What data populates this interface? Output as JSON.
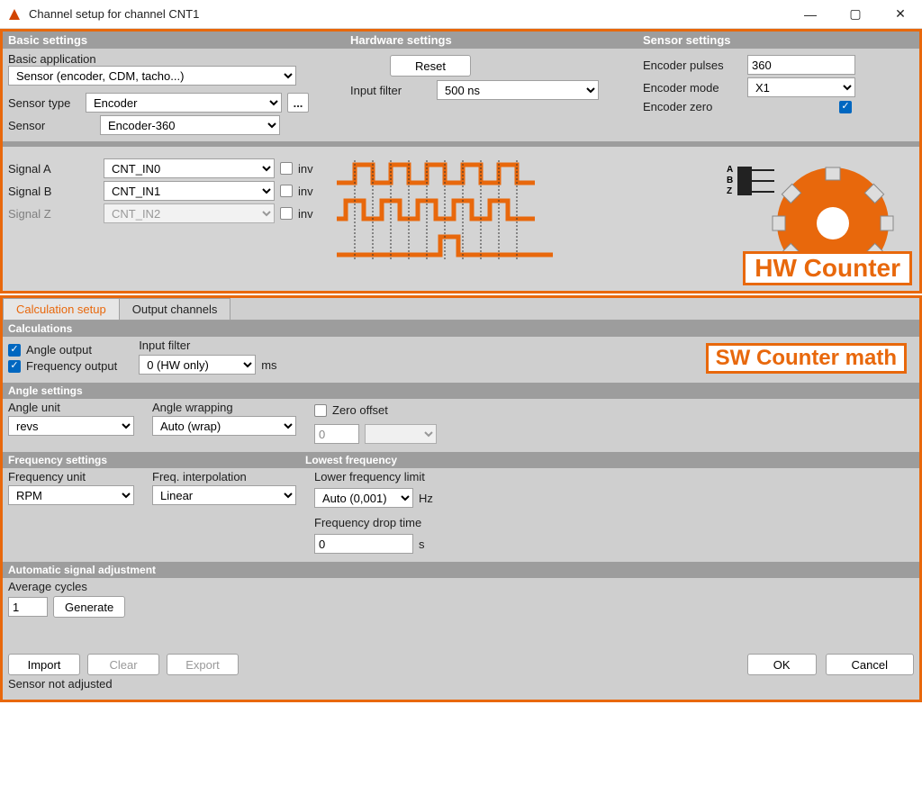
{
  "window": {
    "title": "Channel setup for channel CNT1"
  },
  "headers": {
    "basic": "Basic settings",
    "hardware": "Hardware settings",
    "sensor": "Sensor settings",
    "calc": "Calculations",
    "angle": "Angle settings",
    "freq": "Frequency settings",
    "lowestfreq": "Lowest frequency",
    "auto": "Automatic signal adjustment"
  },
  "basic": {
    "app_label": "Basic application",
    "app_value": "Sensor (encoder, CDM, tacho...)",
    "type_label": "Sensor type",
    "type_value": "Encoder",
    "sensor_label": "Sensor",
    "sensor_value": "Encoder-360",
    "dots": "..."
  },
  "hardware": {
    "reset": "Reset",
    "filter_label": "Input filter",
    "filter_value": "500 ns"
  },
  "sensor": {
    "pulses_label": "Encoder pulses",
    "pulses_value": "360",
    "mode_label": "Encoder mode",
    "mode_value": "X1",
    "zero_label": "Encoder zero"
  },
  "signals": {
    "a_label": "Signal A",
    "a_value": "CNT_IN0",
    "b_label": "Signal B",
    "b_value": "CNT_IN1",
    "z_label": "Signal Z",
    "z_value": "CNT_IN2",
    "inv": "inv",
    "abz_labels": "A\nB\nZ"
  },
  "badges": {
    "hw": "HW Counter",
    "sw": "SW Counter math"
  },
  "tabs": {
    "calc": "Calculation setup",
    "out": "Output channels"
  },
  "calc": {
    "angle_out": "Angle output",
    "freq_out": "Frequency output",
    "input_filter": "Input filter",
    "input_filter_value": "0 (HW only)",
    "ms": "ms"
  },
  "angle": {
    "unit_label": "Angle unit",
    "unit_value": "revs",
    "wrap_label": "Angle wrapping",
    "wrap_value": "Auto (wrap)",
    "zero_offset": "Zero offset",
    "zero_value": "0"
  },
  "freq": {
    "unit_label": "Frequency unit",
    "unit_value": "RPM",
    "interp_label": "Freq. interpolation",
    "interp_value": "Linear",
    "lower_label": "Lower frequency limit",
    "lower_value": "Auto (0,001)",
    "hz": "Hz",
    "drop_label": "Frequency drop time",
    "drop_value": "0",
    "s": "s"
  },
  "auto": {
    "avg_label": "Average cycles",
    "avg_value": "1",
    "generate": "Generate",
    "import": "Import",
    "clear": "Clear",
    "export": "Export",
    "status": "Sensor not adjusted"
  },
  "footer": {
    "ok": "OK",
    "cancel": "Cancel"
  }
}
